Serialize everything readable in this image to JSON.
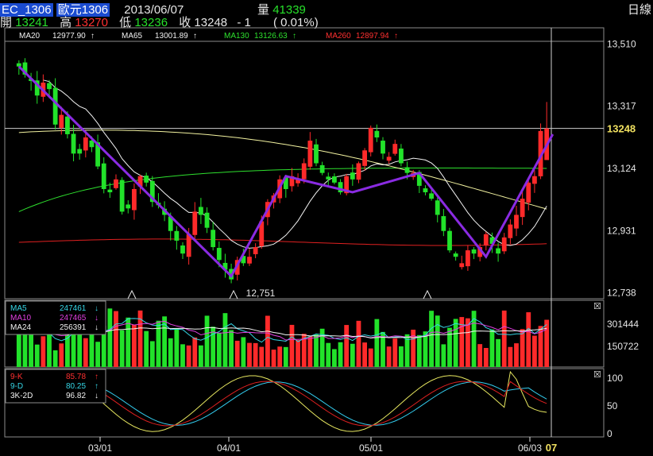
{
  "header": {
    "symbol": "EC_1306",
    "name": "歐元1306",
    "date": "2013/06/07",
    "vol_label": "量",
    "vol_value": "41339",
    "period": "日線",
    "open_label": "開",
    "open_value": "13241",
    "high_label": "高",
    "high_value": "13270",
    "low_label": "低",
    "low_value": "13236",
    "close_label": "收",
    "close_value": "13248",
    "change": "- 1",
    "change_pct": "( 0.01%)"
  },
  "colors": {
    "up": "#ff2a2a",
    "down": "#22e22a",
    "ma20": "#f2f2f2",
    "ma65": "#f2f2a0",
    "ma130": "#2ee02e",
    "ma260": "#e02020",
    "trend": "#8a2be2",
    "k": "#e02020",
    "d": "#33ccee",
    "j": "#e8e860"
  },
  "ma_legend": [
    {
      "label": "MA20",
      "value": "12977.90",
      "arrow": "↑",
      "color": "#f2f2f2"
    },
    {
      "label": "MA65",
      "value": "13001.89",
      "arrow": "↑",
      "color": "#f2f2f2"
    },
    {
      "label": "MA130",
      "value": "13126.63",
      "arrow": "↑",
      "color": "#2ee02e"
    },
    {
      "label": "MA260",
      "value": "12897.94",
      "arrow": "↑",
      "color": "#ff3030"
    }
  ],
  "vol_legend": [
    {
      "label": "MA5",
      "value": "247461",
      "arrow": "↓",
      "color": "#35d6e6"
    },
    {
      "label": "MA10",
      "value": "247465",
      "arrow": "↓",
      "color": "#e040e0"
    },
    {
      "label": "MA24",
      "value": "256391",
      "arrow": "↓",
      "color": "#f2f2f2"
    }
  ],
  "kd_legend": [
    {
      "label": "9-K",
      "value": "85.78",
      "arrow": "↑",
      "color": "#ff3030"
    },
    {
      "label": "9-D",
      "value": "80.25",
      "arrow": "↑",
      "color": "#35d6e6"
    },
    {
      "label": "3K-2D",
      "value": "96.82",
      "arrow": "↓",
      "color": "#f2f2f2"
    }
  ],
  "price_axis": {
    "ticks": [
      "13,510",
      "13,317",
      "13,124",
      "12,931",
      "12,738"
    ],
    "current": "13248",
    "low_marker": "12,751"
  },
  "volume_axis": {
    "ticks": [
      "301444",
      "150722"
    ]
  },
  "kd_axis": {
    "ticks": [
      "100",
      "50",
      "0"
    ]
  },
  "x_axis": {
    "ticks": [
      "03/01",
      "04/01",
      "05/01",
      "06/03"
    ],
    "last": "07"
  },
  "close_marks": [
    "☒",
    "☒"
  ],
  "chart_data": {
    "type": "candlestick",
    "ylim": [
      12720,
      13560
    ],
    "closes": [
      13440,
      13415,
      13395,
      13350,
      13390,
      13370,
      13260,
      13290,
      13230,
      13170,
      13170,
      13220,
      13190,
      13130,
      13060,
      13050,
      13090,
      12990,
      13000,
      13060,
      13100,
      13080,
      13020,
      13010,
      12980,
      12930,
      12900,
      12860,
      12920,
      12990,
      12980,
      12940,
      12880,
      12840,
      12810,
      12780,
      12840,
      12830,
      12850,
      12880,
      12960,
      13020,
      13040,
      13090,
      13060,
      13100,
      13090,
      13140,
      13210,
      13140,
      13110,
      13090,
      13080,
      13050,
      13100,
      13090,
      13140,
      13180,
      13250,
      13220,
      13170,
      13160,
      13200,
      13140,
      13110,
      13110,
      13070,
      13050,
      13030,
      12980,
      12930,
      12870,
      12850,
      12830,
      12870,
      12860,
      12880,
      12920,
      12890,
      12860,
      12910,
      12950,
      12980,
      13030,
      13080,
      13100,
      13240,
      13248
    ]
  }
}
